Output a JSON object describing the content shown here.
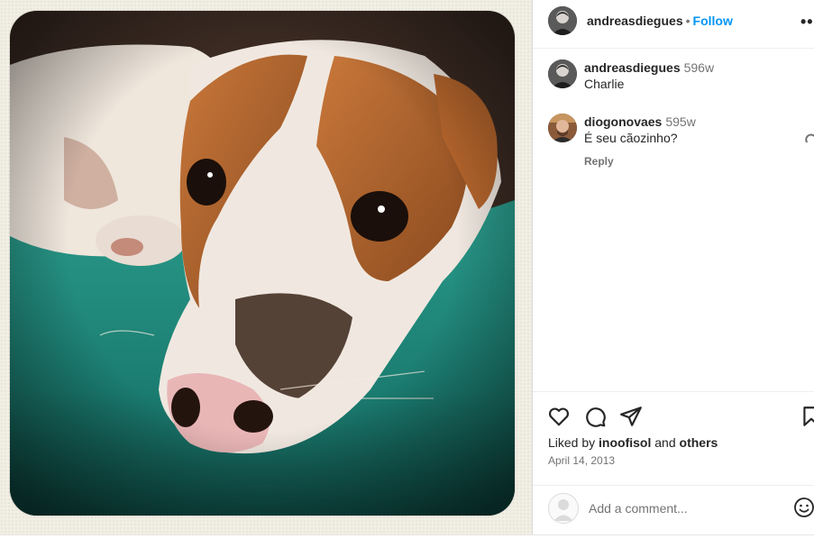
{
  "post": {
    "author": "andreasdiegues",
    "follow_label": "Follow",
    "separator": "•",
    "more_label": "•••"
  },
  "comments": [
    {
      "username": "andreasdiegues",
      "time": "596w",
      "text": "Charlie",
      "reply": ""
    },
    {
      "username": "diogonovaes",
      "time": "595w",
      "text": "É seu cãozinho?",
      "reply": "Reply"
    }
  ],
  "likes": {
    "prefix": "Liked by",
    "user": "inoofisol",
    "conj": "and",
    "others": "others"
  },
  "date": "April 14, 2013",
  "add_comment": {
    "placeholder": "Add a comment..."
  },
  "colors": {
    "accent": "#0095f6",
    "muted": "#737373",
    "teal_blanket": "#1f8a7c"
  },
  "icons": [
    "heart-icon",
    "comment-icon",
    "share-icon",
    "bookmark-icon",
    "emoji-icon",
    "more-icon"
  ]
}
